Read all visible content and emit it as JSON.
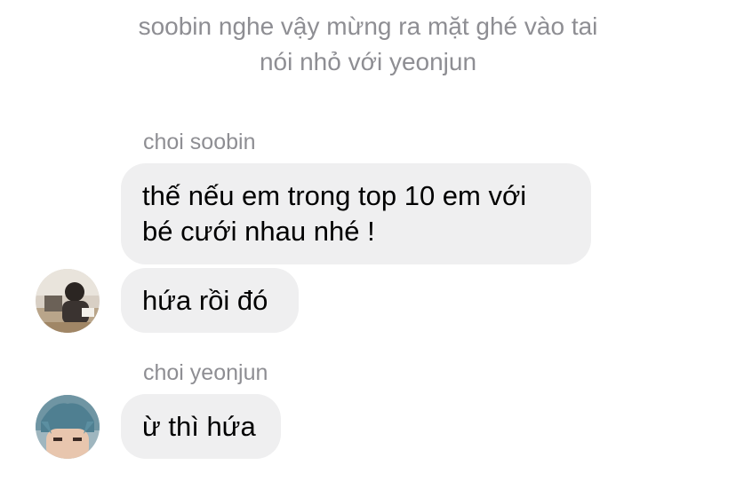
{
  "narration": {
    "line1": "soobin nghe vậy mừng ra mặt ghé vào tai",
    "line2": "nói nhỏ với yeonjun"
  },
  "messages": [
    {
      "sender": "choi soobin",
      "lines": [
        "thế nếu em trong top 10 em với",
        "bé cưới nhau nhé !"
      ]
    },
    {
      "sender": "",
      "lines": [
        "hứa rồi đó"
      ]
    },
    {
      "sender": "choi yeonjun",
      "lines": [
        "ừ thì hứa"
      ]
    }
  ],
  "avatars": [
    {
      "icon": "soobin-avatar-photo"
    },
    {
      "icon": "yeonjun-avatar-photo"
    }
  ],
  "colors": {
    "bubble_bg": "#efeff0",
    "meta_text": "#8e8e93",
    "message_text": "#000000"
  }
}
